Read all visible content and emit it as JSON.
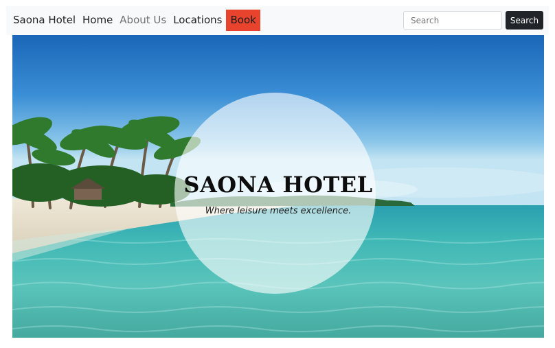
{
  "navbar": {
    "brand": "Saona Hotel",
    "links": [
      {
        "label": "Home"
      },
      {
        "label": "About Us"
      },
      {
        "label": "Locations"
      },
      {
        "label": "Book"
      }
    ],
    "search": {
      "placeholder": "Search",
      "button_label": "Search"
    },
    "book_color": "#e8432d"
  },
  "hero": {
    "title": "SAONA HOTEL",
    "tagline": "Where leisure meets excellence."
  }
}
